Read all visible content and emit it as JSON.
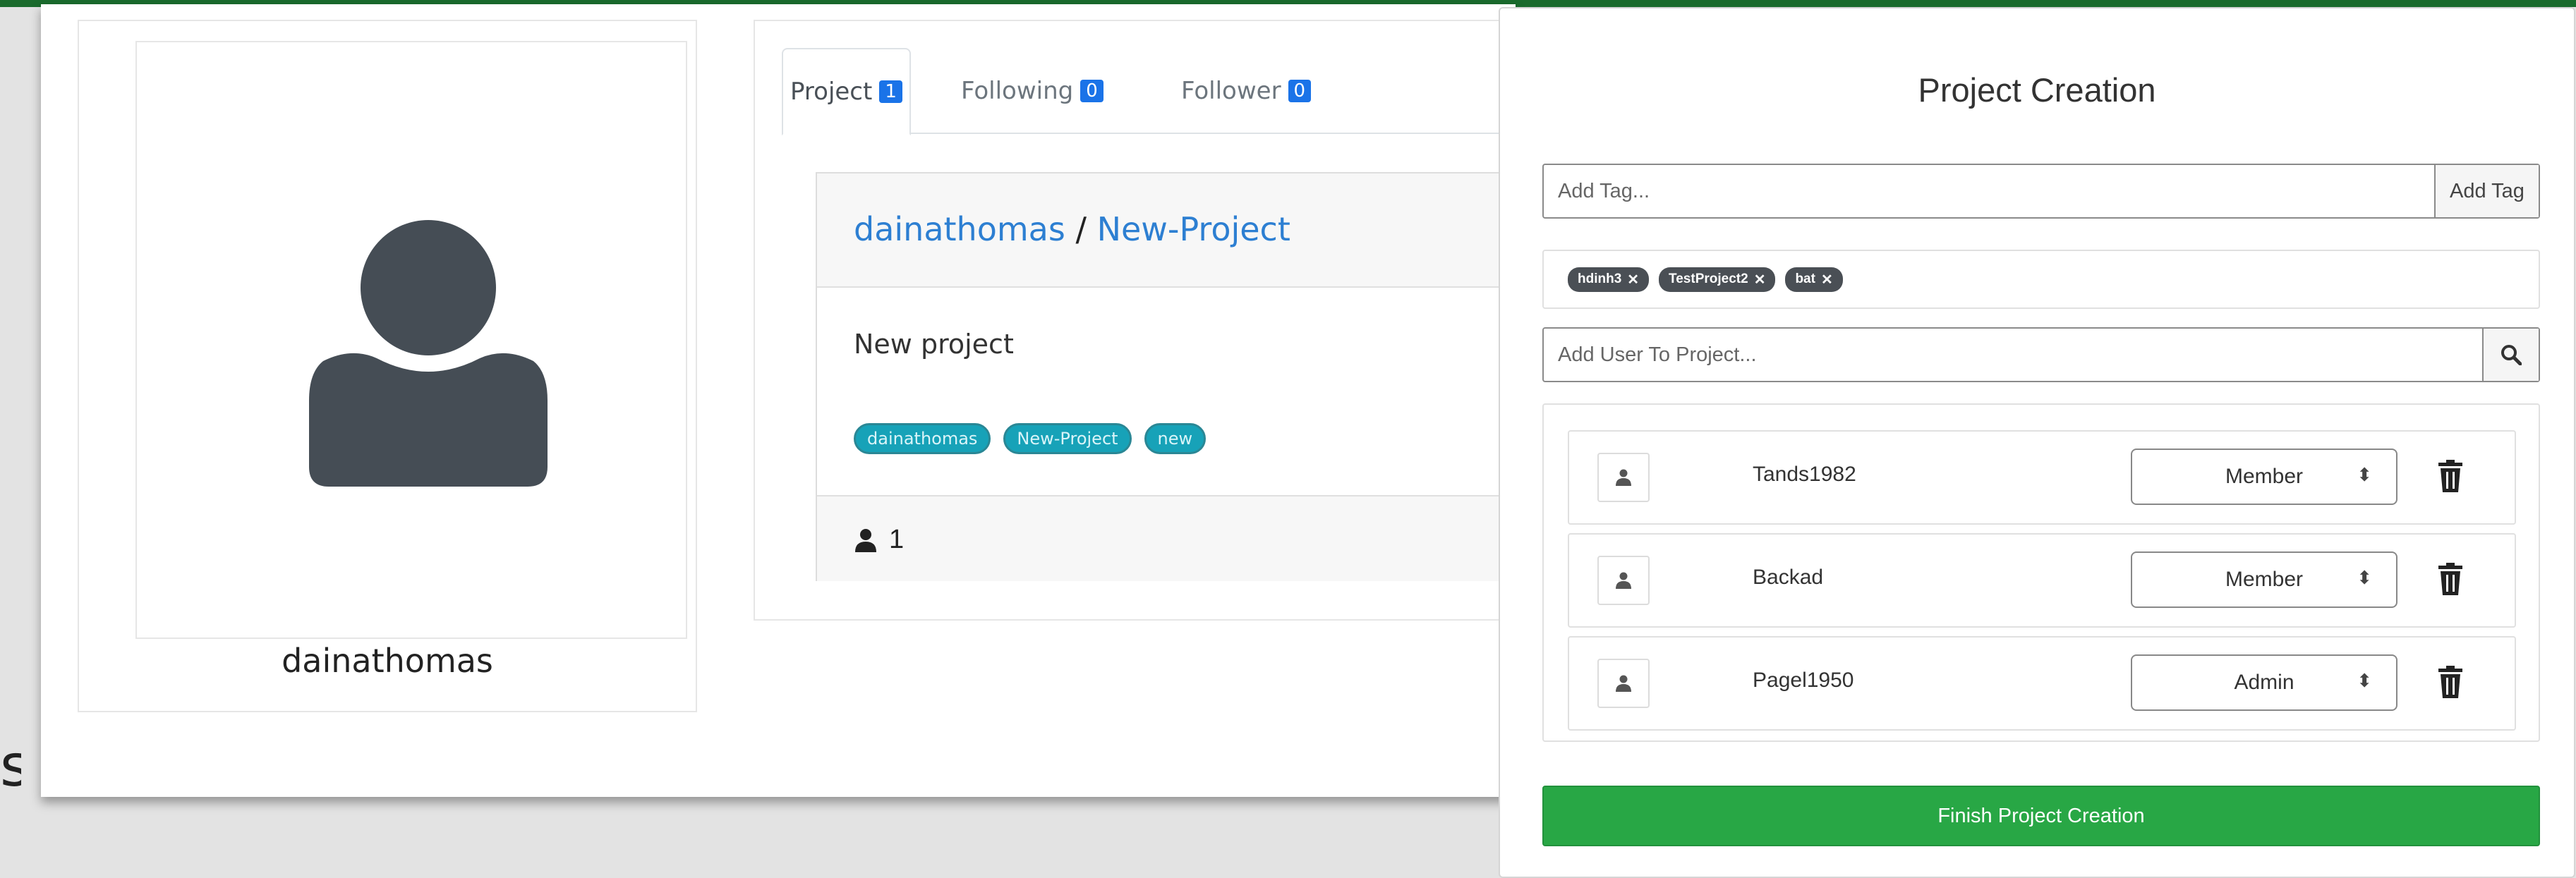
{
  "edge_text": "s",
  "profile": {
    "username": "dainathomas"
  },
  "tabs": [
    {
      "label": "Project",
      "count": "1",
      "active": true
    },
    {
      "label": "Following",
      "count": "0",
      "active": false
    },
    {
      "label": "Follower",
      "count": "0",
      "active": false
    }
  ],
  "project_card": {
    "owner": "dainathomas",
    "separator": "/",
    "name": "New-Project",
    "description": "New project",
    "tags": [
      "dainathomas",
      "New-Project",
      "new"
    ],
    "member_count": "1"
  },
  "modal": {
    "title": "Project Creation",
    "tag_input": {
      "placeholder": "Add Tag...",
      "value": ""
    },
    "add_tag_label": "Add Tag",
    "chips": [
      "hdinh3",
      "TestProject2",
      "bat"
    ],
    "chip_remove_glyph": "✕",
    "user_input": {
      "placeholder": "Add User To Project...",
      "value": ""
    },
    "users": [
      {
        "name": "Tands1982",
        "role": "Member"
      },
      {
        "name": "Backad",
        "role": "Member"
      },
      {
        "name": "Pagel1950",
        "role": "Admin"
      }
    ],
    "select_caret": "⬍",
    "finish_label": "Finish Project Creation"
  },
  "colors": {
    "accent_green": "#28a745",
    "top_bar": "#1a6b2d",
    "link_blue": "#2d7fd2",
    "tag_teal": "#17a2b8",
    "badge_blue": "#1a73e8",
    "chip_dark": "#4a4f55",
    "avatar_gray": "#454d55"
  },
  "icons": {
    "avatar": "user-silhouette-icon",
    "member": "user-icon",
    "search": "search-icon",
    "delete": "trash-icon"
  }
}
